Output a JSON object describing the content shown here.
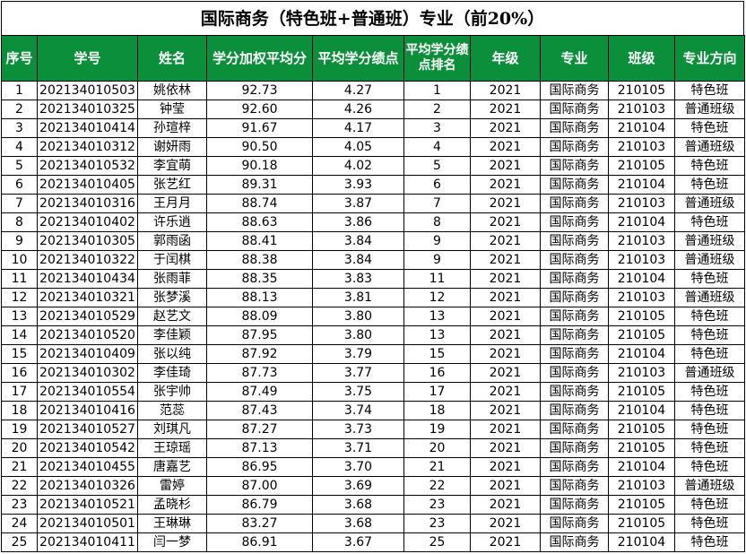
{
  "title": "国际商务（特色班+普通班）专业（前20%）",
  "headers": [
    "序号",
    "学号",
    "姓名",
    "学分加权平均分",
    "平均学分绩点",
    "平均学分绩点排名",
    "年级",
    "专业",
    "班级",
    "专业方向"
  ],
  "colors": {
    "header_bg": "#0b8f3a",
    "header_text": "#ffffff"
  },
  "rows": [
    [
      "1",
      "202134010503",
      "姚依林",
      "92.73",
      "4.27",
      "1",
      "2021",
      "国际商务",
      "210105",
      "特色班"
    ],
    [
      "2",
      "202134010325",
      "钟莹",
      "92.60",
      "4.26",
      "2",
      "2021",
      "国际商务",
      "210103",
      "普通班级"
    ],
    [
      "3",
      "202134010414",
      "孙瑄梓",
      "91.67",
      "4.17",
      "3",
      "2021",
      "国际商务",
      "210104",
      "特色班"
    ],
    [
      "4",
      "202134010312",
      "谢妍雨",
      "90.50",
      "4.05",
      "4",
      "2021",
      "国际商务",
      "210103",
      "普通班级"
    ],
    [
      "5",
      "202134010532",
      "李宜萌",
      "90.18",
      "4.02",
      "5",
      "2021",
      "国际商务",
      "210105",
      "特色班"
    ],
    [
      "6",
      "202134010405",
      "张艺红",
      "89.31",
      "3.93",
      "6",
      "2021",
      "国际商务",
      "210104",
      "特色班"
    ],
    [
      "7",
      "202134010316",
      "王月月",
      "88.74",
      "3.87",
      "7",
      "2021",
      "国际商务",
      "210103",
      "普通班级"
    ],
    [
      "8",
      "202134010402",
      "许乐逍",
      "88.63",
      "3.86",
      "8",
      "2021",
      "国际商务",
      "210104",
      "特色班"
    ],
    [
      "9",
      "202134010305",
      "郭雨函",
      "88.41",
      "3.84",
      "9",
      "2021",
      "国际商务",
      "210103",
      "普通班级"
    ],
    [
      "10",
      "202134010322",
      "于闰棋",
      "88.38",
      "3.84",
      "9",
      "2021",
      "国际商务",
      "210103",
      "普通班级"
    ],
    [
      "11",
      "202134010434",
      "张雨菲",
      "88.35",
      "3.83",
      "11",
      "2021",
      "国际商务",
      "210104",
      "特色班"
    ],
    [
      "12",
      "202134010321",
      "张梦溪",
      "88.13",
      "3.81",
      "12",
      "2021",
      "国际商务",
      "210103",
      "普通班级"
    ],
    [
      "13",
      "202134010529",
      "赵艺文",
      "88.09",
      "3.80",
      "13",
      "2021",
      "国际商务",
      "210105",
      "特色班"
    ],
    [
      "14",
      "202134010520",
      "李佳颖",
      "87.95",
      "3.80",
      "13",
      "2021",
      "国际商务",
      "210105",
      "特色班"
    ],
    [
      "15",
      "202134010409",
      "张以纯",
      "87.92",
      "3.79",
      "15",
      "2021",
      "国际商务",
      "210104",
      "特色班"
    ],
    [
      "16",
      "202134010302",
      "李佳琦",
      "87.73",
      "3.77",
      "16",
      "2021",
      "国际商务",
      "210103",
      "普通班级"
    ],
    [
      "17",
      "202134010554",
      "张宇帅",
      "87.49",
      "3.75",
      "17",
      "2021",
      "国际商务",
      "210105",
      "特色班"
    ],
    [
      "18",
      "202134010416",
      "范蕊",
      "87.43",
      "3.74",
      "18",
      "2021",
      "国际商务",
      "210104",
      "特色班"
    ],
    [
      "19",
      "202134010527",
      "刘琪凡",
      "87.27",
      "3.73",
      "19",
      "2021",
      "国际商务",
      "210105",
      "特色班"
    ],
    [
      "20",
      "202134010542",
      "王琼瑶",
      "87.13",
      "3.71",
      "20",
      "2021",
      "国际商务",
      "210105",
      "特色班"
    ],
    [
      "21",
      "202134010455",
      "唐嘉艺",
      "86.95",
      "3.70",
      "21",
      "2021",
      "国际商务",
      "210104",
      "特色班"
    ],
    [
      "22",
      "202134010326",
      "雷婷",
      "87.00",
      "3.69",
      "22",
      "2021",
      "国际商务",
      "210103",
      "普通班级"
    ],
    [
      "23",
      "202134010521",
      "孟晓杉",
      "86.79",
      "3.68",
      "23",
      "2021",
      "国际商务",
      "210105",
      "特色班"
    ],
    [
      "24",
      "202134010501",
      "王琳琳",
      "83.27",
      "3.68",
      "23",
      "2021",
      "国际商务",
      "210105",
      "特色班"
    ],
    [
      "25",
      "202134010411",
      "闫一梦",
      "86.91",
      "3.67",
      "25",
      "2021",
      "国际商务",
      "210104",
      "特色班"
    ]
  ]
}
